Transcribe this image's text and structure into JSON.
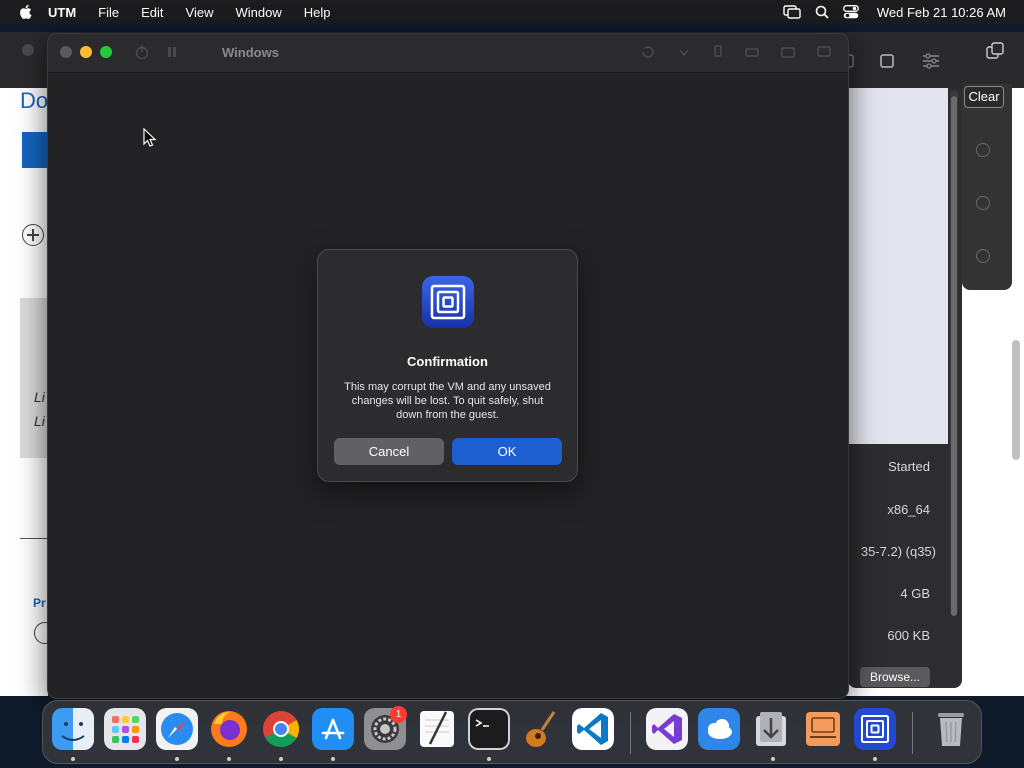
{
  "menubar": {
    "app": "UTM",
    "items": [
      "File",
      "Edit",
      "View",
      "Window",
      "Help"
    ],
    "clock": "Wed Feb 21  10:26 AM"
  },
  "background_window": {
    "left_heading": "Do",
    "left_italic_1": "Li",
    "left_italic_2": "Li",
    "left_section": "Pr",
    "clear_label": "Clear",
    "details": [
      "Started",
      "x86_64",
      "35-7.2) (q35)",
      "4 GB",
      "600 KB"
    ],
    "browse_label": "Browse..."
  },
  "vm_window": {
    "title": "Windows"
  },
  "dialog": {
    "title": "Confirmation",
    "message": "This may corrupt the VM and any unsaved changes will be lost. To quit safely, shut down from the guest.",
    "cancel_label": "Cancel",
    "ok_label": "OK"
  },
  "dock": {
    "badge_count": "1",
    "apps": [
      "finder-icon",
      "launchpad-icon",
      "safari-icon",
      "firefox-icon",
      "chrome-icon",
      "app-store-icon",
      "system-settings-icon",
      "textedit-icon",
      "terminal-icon",
      "garageband-icon",
      "vscode-icon",
      "visual-studio-icon",
      "weather-icon",
      "downloads-icon",
      "preview-icon",
      "utm-icon",
      "trash-icon"
    ]
  }
}
